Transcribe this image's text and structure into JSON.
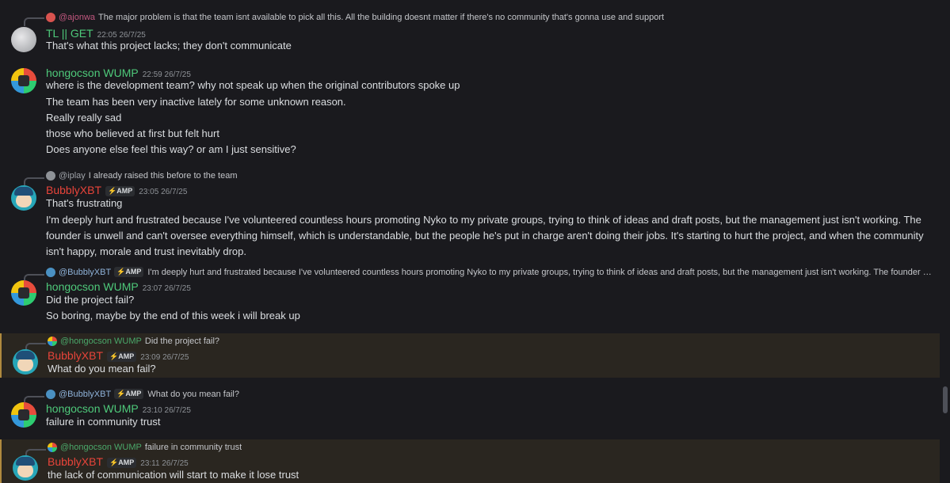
{
  "messages": [
    {
      "reply": {
        "name": "@ajonwa",
        "text": "The major problem is that the team isnt available to pick all this.  All the building doesnt matter if there's no community that's gonna use and support"
      },
      "author": "TL || GET",
      "timestamp": "22:05 26/7/25",
      "lines": [
        "That's what this project lacks; they don't communicate"
      ]
    },
    {
      "author": "hongocson WUMP",
      "timestamp": "22:59 26/7/25",
      "lines": [
        "where is the development team? why not speak up when the original contributors spoke up",
        "The team has been very inactive lately for some unknown reason.",
        "Really really sad",
        "those who believed at first but felt hurt",
        "Does anyone else feel this way? or am I just sensitive?"
      ]
    },
    {
      "reply": {
        "name": "@iplay",
        "text": "I already raised this before to the team"
      },
      "author": "BubblyXBT",
      "tag": "⚡AMP",
      "timestamp": "23:05 26/7/25",
      "lines": [
        "That's frustrating",
        "I'm deeply hurt and frustrated because I've volunteered countless hours promoting Nyko to my private groups, trying to think of ideas and draft posts, but the management just isn't working. The founder is unwell and can't oversee everything himself, which is understandable, but the people he's put in charge aren't doing their jobs. It's starting to hurt the project, and when the community isn't happy, morale and trust inevitably drop."
      ]
    },
    {
      "reply": {
        "name": "@BubblyXBT",
        "tag": "⚡AMP",
        "text": "I'm deeply hurt and frustrated because I've volunteered countless hours promoting Nyko to my private groups, trying to think of ideas and draft posts, but the management just isn't working. The founder is unwell an..."
      },
      "author": "hongocson WUMP",
      "timestamp": "23:07 26/7/25",
      "lines": [
        "Did the project fail?",
        "So boring, maybe by the end of this week i will break up"
      ]
    },
    {
      "reply": {
        "name": "@hongocson WUMP",
        "text": "Did the project fail?"
      },
      "author": "BubblyXBT",
      "tag": "⚡AMP",
      "timestamp": "23:09 26/7/25",
      "lines": [
        "What do you mean fail?"
      ]
    },
    {
      "reply": {
        "name": "@BubblyXBT",
        "tag": "⚡AMP",
        "text": "What do you mean fail?"
      },
      "author": "hongocson WUMP",
      "timestamp": "23:10 26/7/25",
      "lines": [
        "failure in community trust"
      ]
    },
    {
      "reply": {
        "name": "@hongocson WUMP",
        "text": "failure in community trust"
      },
      "author": "BubblyXBT",
      "tag": "⚡AMP",
      "timestamp": "23:11 26/7/25",
      "lines": [
        "the lack of communication will start to make it lose trust"
      ]
    }
  ]
}
